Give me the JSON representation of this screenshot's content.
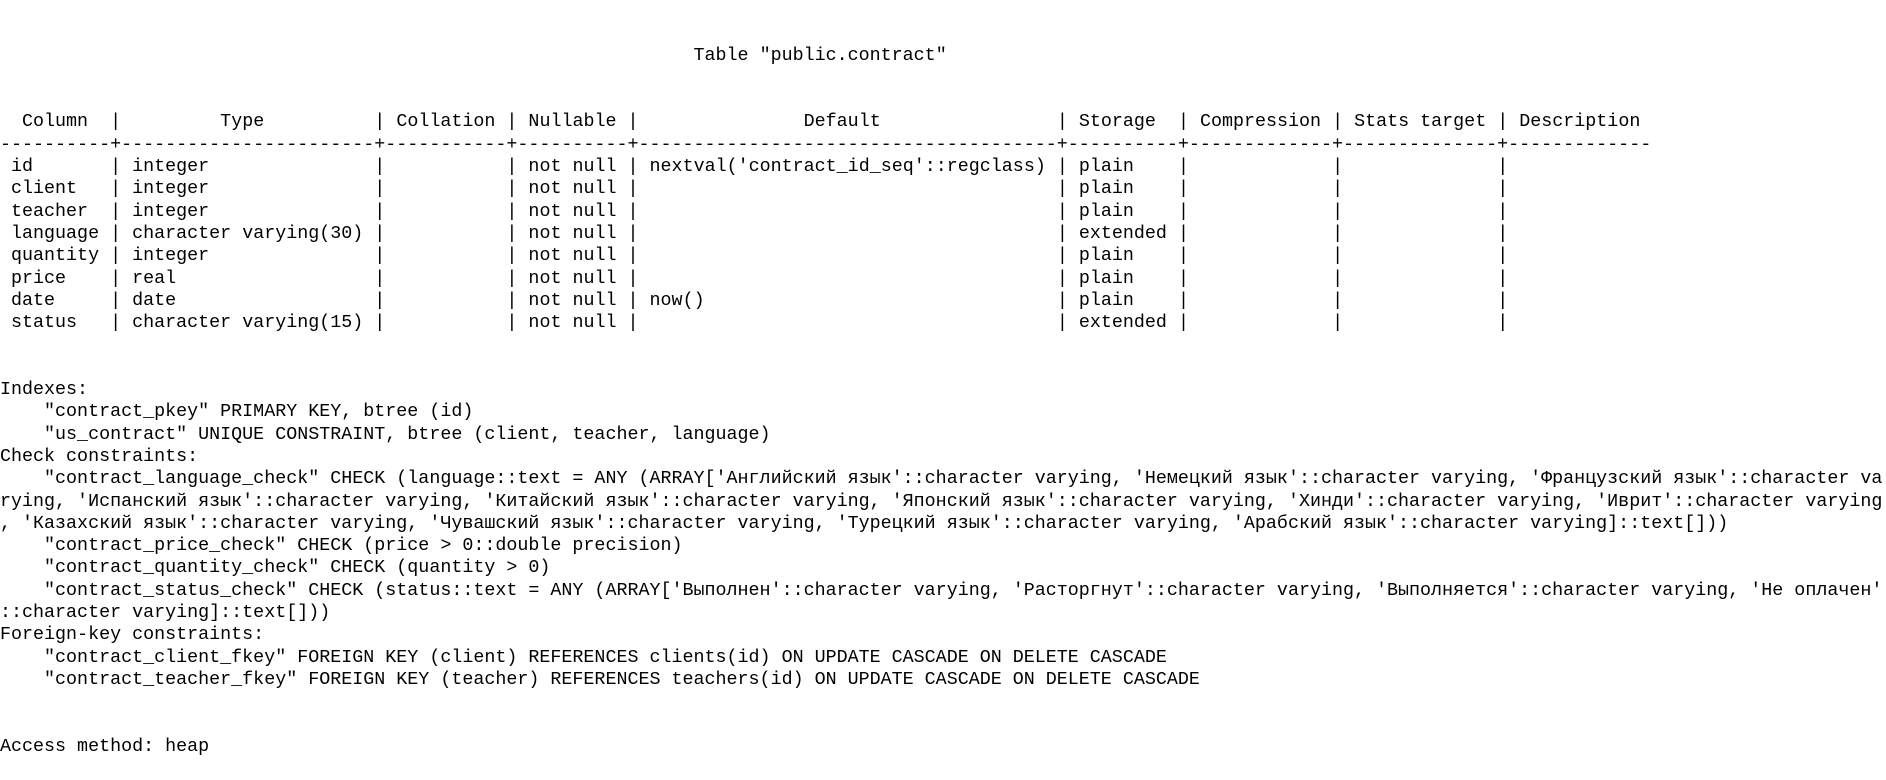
{
  "title": "Table \"public.contract\"",
  "table": {
    "headers": [
      "Column",
      "Type",
      "Collation",
      "Nullable",
      "Default",
      "Storage",
      "Compression",
      "Stats target",
      "Description"
    ],
    "rows": [
      [
        "id",
        "integer",
        "",
        "not null",
        "nextval('contract_id_seq'::regclass)",
        "plain",
        "",
        "",
        ""
      ],
      [
        "client",
        "integer",
        "",
        "not null",
        "",
        "plain",
        "",
        "",
        ""
      ],
      [
        "teacher",
        "integer",
        "",
        "not null",
        "",
        "plain",
        "",
        "",
        ""
      ],
      [
        "language",
        "character varying(30)",
        "",
        "not null",
        "",
        "extended",
        "",
        "",
        ""
      ],
      [
        "quantity",
        "integer",
        "",
        "not null",
        "",
        "plain",
        "",
        "",
        ""
      ],
      [
        "price",
        "real",
        "",
        "not null",
        "",
        "plain",
        "",
        "",
        ""
      ],
      [
        "date",
        "date",
        "",
        "not null",
        "now()",
        "plain",
        "",
        "",
        ""
      ],
      [
        "status",
        "character varying(15)",
        "",
        "not null",
        "",
        "extended",
        "",
        "",
        ""
      ]
    ]
  },
  "sections": [
    {
      "heading": "Indexes:",
      "items": [
        "\"contract_pkey\" PRIMARY KEY, btree (id)",
        "\"us_contract\" UNIQUE CONSTRAINT, btree (client, teacher, language)"
      ]
    },
    {
      "heading": "Check constraints:",
      "items": [
        "\"contract_language_check\" CHECK (language::text = ANY (ARRAY['Английский язык'::character varying, 'Немецкий язык'::character varying, 'Французский язык'::character varying, 'Испанский язык'::character varying, 'Китайский язык'::character varying, 'Японский язык'::character varying, 'Хинди'::character varying, 'Иврит'::character varying, 'Казахский язык'::character varying, 'Чувашский язык'::character varying, 'Турецкий язык'::character varying, 'Арабский язык'::character varying]::text[]))",
        "\"contract_price_check\" CHECK (price > 0::double precision)",
        "\"contract_quantity_check\" CHECK (quantity > 0)",
        "\"contract_status_check\" CHECK (status::text = ANY (ARRAY['Выполнен'::character varying, 'Расторгнут'::character varying, 'Выполняется'::character varying, 'Не оплачен'::character varying]::text[]))"
      ]
    },
    {
      "heading": "Foreign-key constraints:",
      "items": [
        "\"contract_client_fkey\" FOREIGN KEY (client) REFERENCES clients(id) ON UPDATE CASCADE ON DELETE CASCADE",
        "\"contract_teacher_fkey\" FOREIGN KEY (teacher) REFERENCES teachers(id) ON UPDATE CASCADE ON DELETE CASCADE"
      ]
    }
  ],
  "access_method": "Access method: heap"
}
